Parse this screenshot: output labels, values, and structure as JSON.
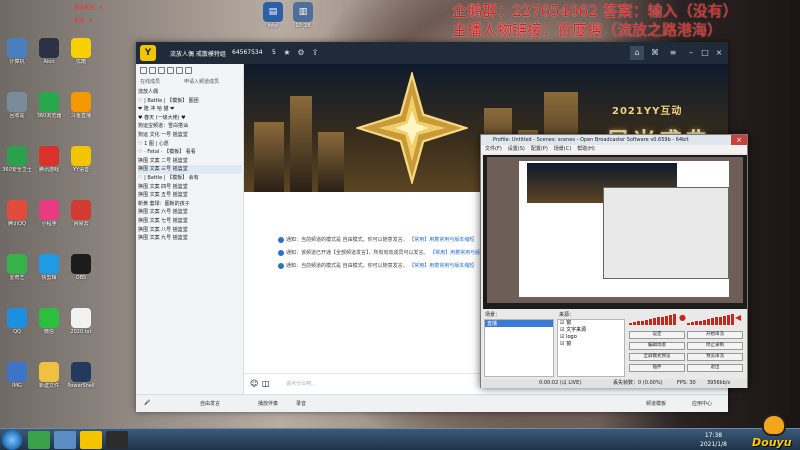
{
  "overlay": {
    "qq_group_line": "企鹅群：227654062 答案：输入（没有）",
    "anchor_link_line": "主播人物链接：百度搜（流放之路港海）",
    "stream_stats": [
      "箱体悬挂：4",
      "系统：0"
    ],
    "watermark": "Douyu"
  },
  "desktop_icons": [
    {
      "label": "计算机",
      "icon": "computer-icon",
      "color": "#4a7fbf"
    },
    {
      "label": "回收站",
      "icon": "recycle-bin-icon",
      "color": "#7a8b9b"
    },
    {
      "label": "360安全卫士",
      "icon": "shield-icon",
      "color": "#2aa14a"
    },
    {
      "label": "腾讯QQ",
      "icon": "qq-icon",
      "color": "#e24a3a"
    },
    {
      "label": "爱奇艺",
      "icon": "iqiyi-icon",
      "color": "#36b24a"
    },
    {
      "label": "QQ",
      "icon": "qq-penguin-icon",
      "color": "#1b8fe0"
    },
    {
      "label": "IMG",
      "icon": "image-icon",
      "color": "#3e74c8"
    },
    {
      "label": "Aion",
      "icon": "game-icon",
      "color": "#2b3245"
    },
    {
      "label": "360浏览器",
      "icon": "browser-icon",
      "color": "#28a84a"
    },
    {
      "label": "腾讯游戏",
      "icon": "game-center-icon",
      "color": "#d8322a"
    },
    {
      "label": "小程序",
      "icon": "app-icon",
      "color": "#e93c80"
    },
    {
      "label": "快剪辑",
      "icon": "video-icon",
      "color": "#1f9be6"
    },
    {
      "label": "微信",
      "icon": "wechat-icon",
      "color": "#2dbd3f"
    },
    {
      "label": "新建文件",
      "icon": "folder-icon",
      "color": "#f0c040"
    },
    {
      "label": "优酷",
      "icon": "youku-icon",
      "color": "#f7d000"
    },
    {
      "label": "斗鱼直播",
      "icon": "douyu-icon",
      "color": "#f39800"
    },
    {
      "label": "YY语音",
      "icon": "yy-icon",
      "color": "#f5c400"
    },
    {
      "label": "网易云",
      "icon": "cloud-icon",
      "color": "#d33a31"
    },
    {
      "label": "OBS",
      "icon": "obs-icon",
      "color": "#1c1c1c"
    },
    {
      "label": "2020.txt",
      "icon": "document-icon",
      "color": "#f2f2f2"
    },
    {
      "label": "PowerShell",
      "icon": "terminal-icon",
      "color": "#223a5e"
    }
  ],
  "yy": {
    "title": "流放人偶 戒散模特组",
    "room_id": "64567534",
    "channel_count": "5",
    "tabs": [
      "在线成员",
      "申请入频道成员"
    ],
    "tree": [
      {
        "text": "流放人偶",
        "sel": false
      },
      {
        "text": "♡ | Battle | 【模板】 图团",
        "sel": false
      },
      {
        "text": "❤ 隆 冲 哈 猫 ❤",
        "sel": false
      },
      {
        "text": "♥ 春天 (一级大佬) ♥",
        "sel": false
      },
      {
        "text": "狗运宝频道：雪白搭讪",
        "sel": false
      },
      {
        "text": "狗运 文化 一号 摇篮堂",
        "sel": false
      },
      {
        "text": "♡ 1 图 | 心愿",
        "sel": false
      },
      {
        "text": "♡ · Fetal · 【模板】 看看",
        "sel": false
      },
      {
        "text": "换围 文案 二号 摇篮堂",
        "sel": false
      },
      {
        "text": "换围 文案 三号 摇篮堂",
        "sel": true
      },
      {
        "text": "♡ | Battle | 【模板】 会有",
        "sel": false
      },
      {
        "text": "换围 文案 四号 摇篮堂",
        "sel": false
      },
      {
        "text": "换围 文案 五号 摇篮堂",
        "sel": false
      },
      {
        "text": "新黄 套球：图板的孩子",
        "sel": false
      },
      {
        "text": "换围 文案 六号 摇篮堂",
        "sel": false
      },
      {
        "text": "换围 文案 七号 摇篮堂",
        "sel": false
      },
      {
        "text": "换围 文案 八号 摇篮堂",
        "sel": false
      },
      {
        "text": "换围 文案 九号 摇篮堂",
        "sel": false
      }
    ],
    "banner_sub": "2021YY互动",
    "banner_main": "星光盛典",
    "messages": [
      {
        "text": "通知：当前频道的模式是 自由模式，你可以随意发言。",
        "link": "【常用】用着常用与版本缩短"
      },
      {
        "text": "通知：该频道已开通【全部频道发言】，所有有效成员可以发言。",
        "link": "【常用】用着常用与版本"
      },
      {
        "text": "通知：当前频道的模式是 自由模式，你可以随意发言。",
        "link": "【常用】用着常用与版本缩短"
      }
    ],
    "input_placeholder": "说点什么吧...",
    "bottom": [
      "自由发言",
      "播放伴奏",
      "录音",
      "频道模板",
      "应用中心"
    ]
  },
  "obs": {
    "title": "Profile: Untitled - Scenes: scenes - Open Broadcaster Software v0.659b - 64bit",
    "menu": [
      "文件(F)",
      "设置(S)",
      "配置(P)",
      "场景(C)",
      "帮助(H)"
    ],
    "scenes_label": "场景：",
    "sources_label": "来源：",
    "scene_items": [
      "直播"
    ],
    "sources": [
      "窗",
      "文字来源",
      "logo",
      "窗"
    ],
    "buttons": [
      "设定",
      "开始串流",
      "编辑场景",
      "停止录制",
      "全屏模式预览",
      "预览串流",
      "插件",
      "退出"
    ],
    "status": {
      "time": "0:00:02 (以 LIVE)",
      "dropped": "丢失帧数：0 (0.00%)",
      "fps": "FPS: 30",
      "kbps": "3956kb/s"
    }
  },
  "desktop_top": {
    "task1": "Intel",
    "task2": "10_28"
  },
  "taskbar": {
    "time": "17:38",
    "date": "2021/1/8"
  }
}
